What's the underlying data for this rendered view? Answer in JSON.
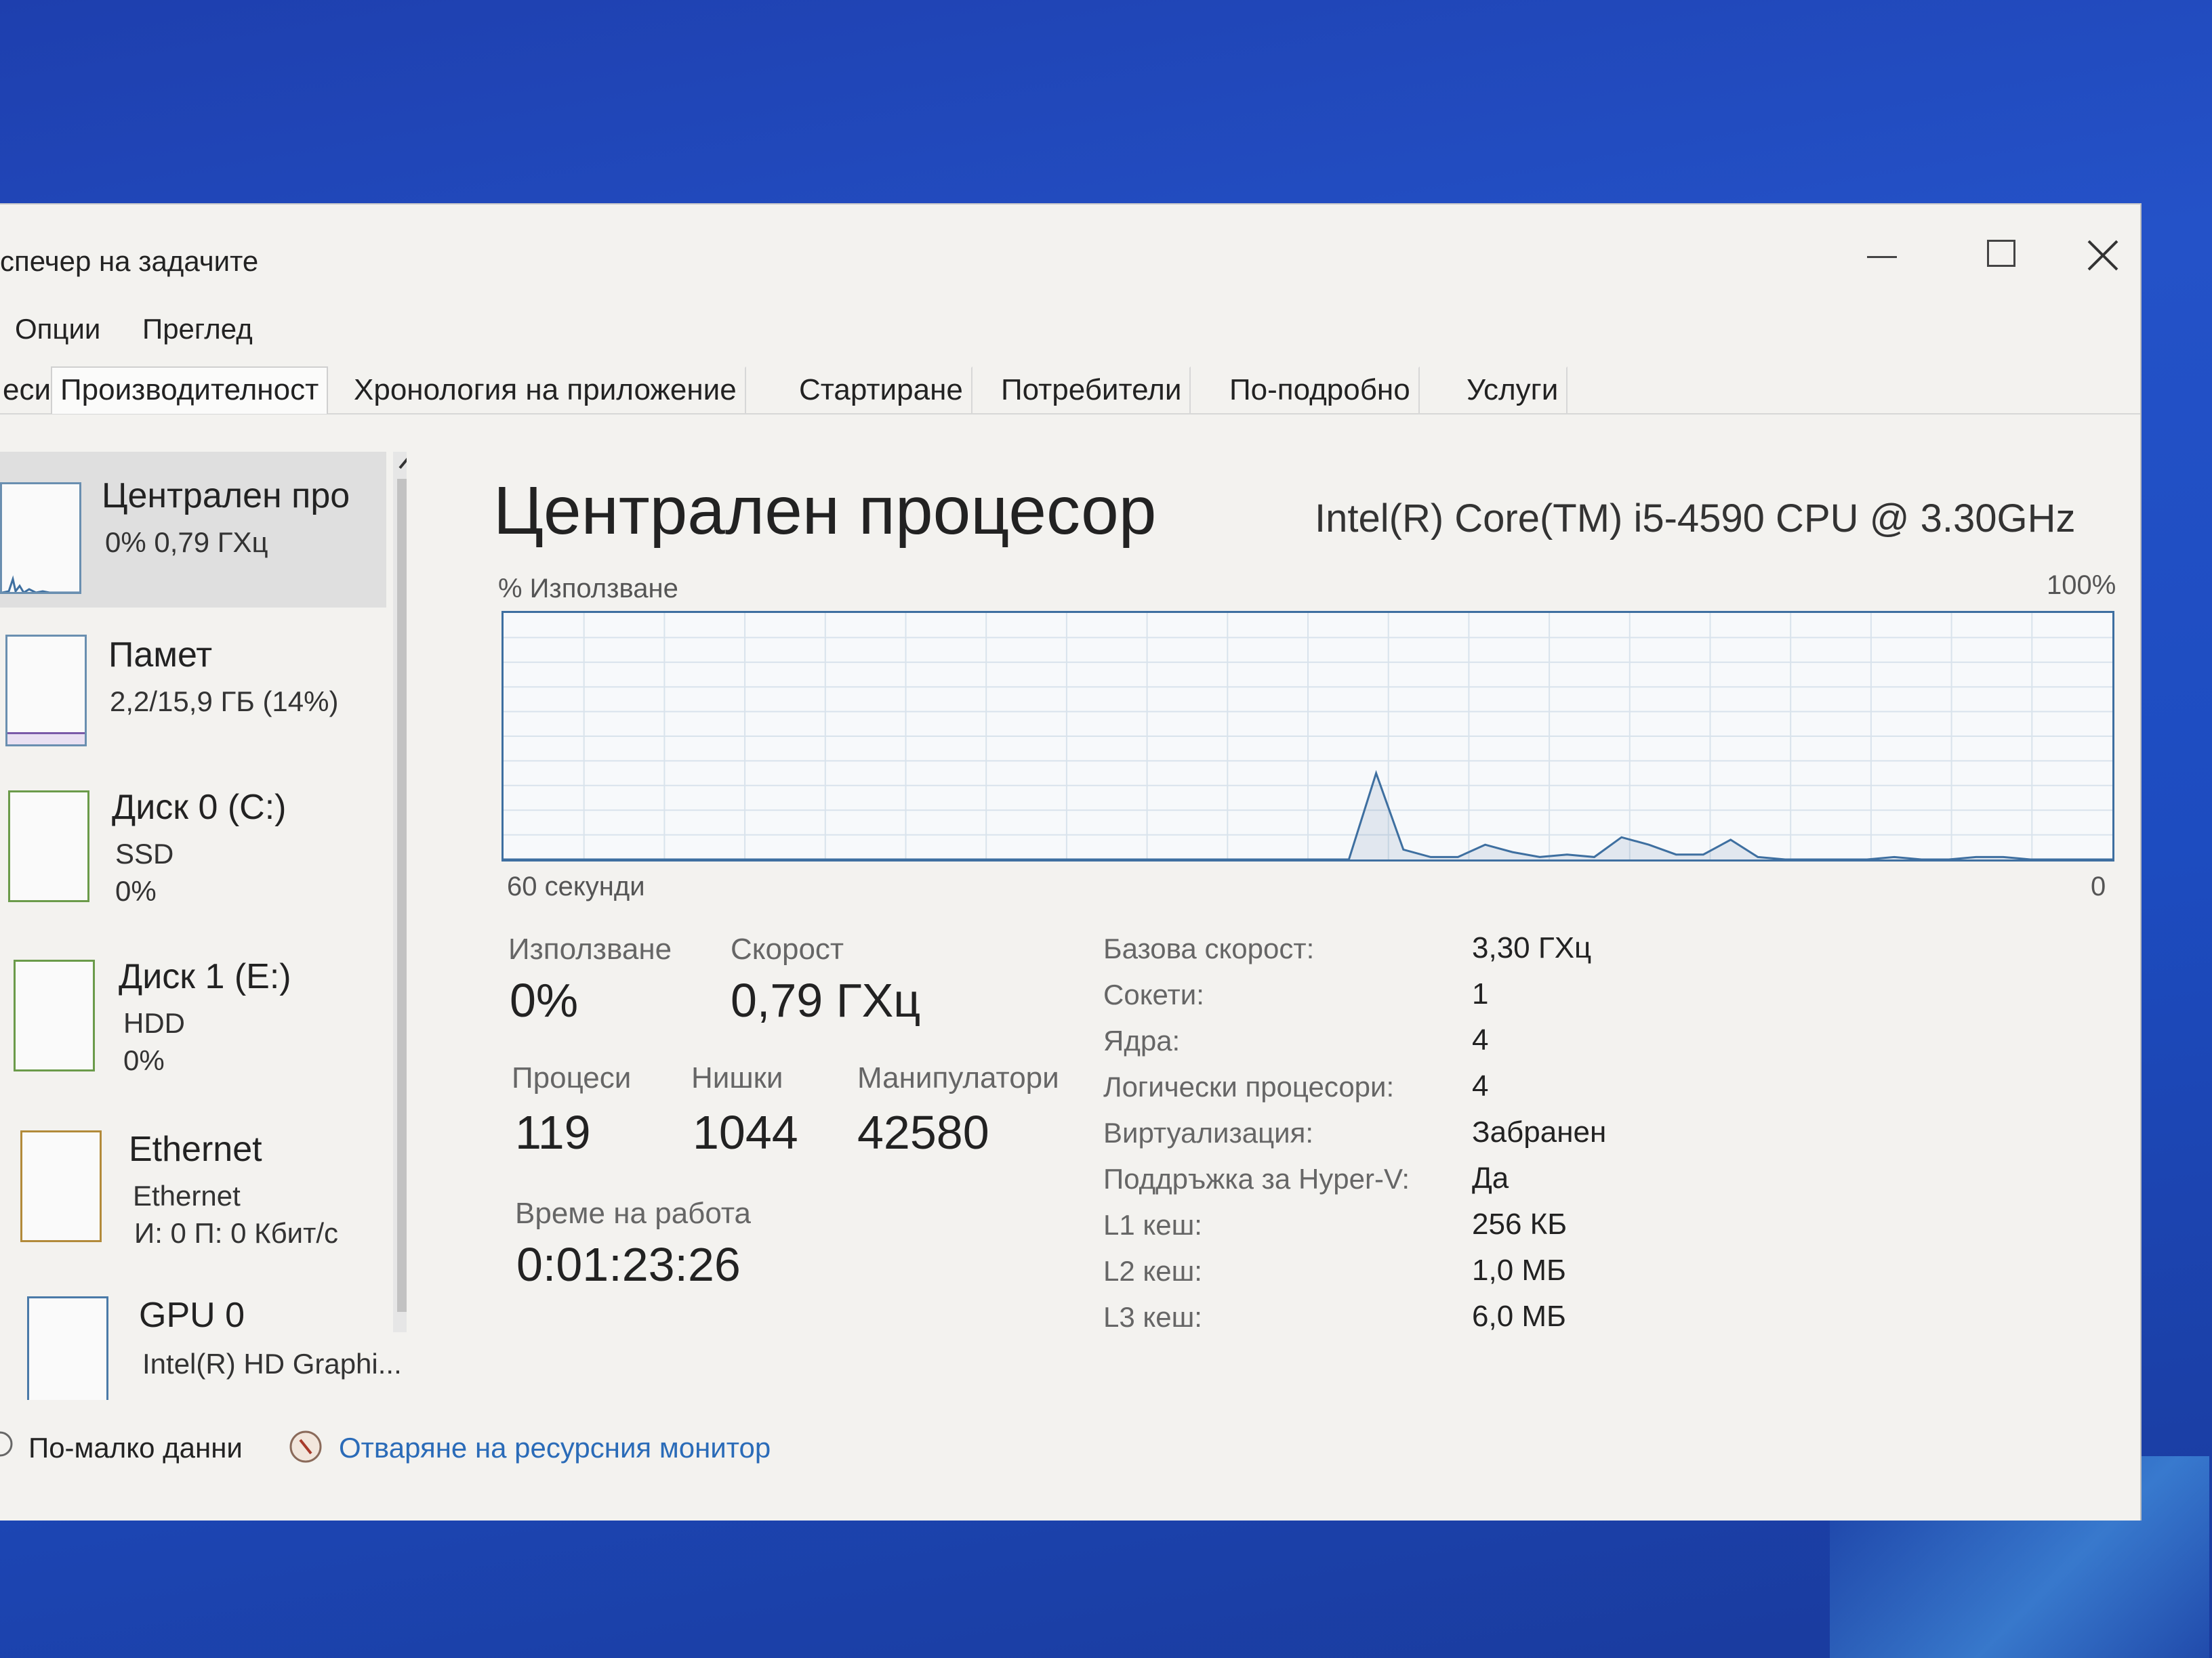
{
  "window": {
    "title": "спечер на задачите",
    "controls": {
      "minimize": "minimize",
      "maximize": "maximize",
      "close": "close"
    }
  },
  "menu": {
    "items": [
      "Опции",
      "Преглед"
    ]
  },
  "tabs": [
    "еси",
    "Производителност",
    "Хронология на приложение",
    "Стартиране",
    "Потребители",
    "По-подробно",
    "Услуги"
  ],
  "active_tab": "Производителност",
  "sidebar": {
    "items": [
      {
        "title": "Централен про",
        "sub1": "0% 0,79 ГХц",
        "sub2": ""
      },
      {
        "title": "Памет",
        "sub1": "2,2/15,9 ГБ (14%)",
        "sub2": ""
      },
      {
        "title": "Диск 0 (C:)",
        "sub1": "SSD",
        "sub2": "0%"
      },
      {
        "title": "Диск 1 (E:)",
        "sub1": "HDD",
        "sub2": "0%"
      },
      {
        "title": "Ethernet",
        "sub1": "Ethernet",
        "sub2": "И: 0 П: 0 Кбит/с"
      },
      {
        "title": "GPU 0",
        "sub1": "Intel(R) HD Graphi...",
        "sub2": ""
      }
    ]
  },
  "main": {
    "title": "Централен процесор",
    "cpu_model": "Intel(R) Core(TM) i5-4590 CPU @ 3.30GHz",
    "graph": {
      "y_label": "% Използване",
      "y_max_label": "100%",
      "x_left_label": "60 секунди",
      "x_right_label": "0",
      "usage_series": [
        0,
        0,
        0,
        0,
        0,
        0,
        0,
        0,
        0,
        0,
        0,
        0,
        0,
        0,
        0,
        0,
        0,
        0,
        0,
        0,
        0,
        0,
        0,
        0,
        0,
        0,
        0,
        0,
        0,
        0,
        0,
        0,
        35,
        4,
        1,
        1,
        6,
        3,
        1,
        2,
        1,
        9,
        6,
        2,
        2,
        8,
        1,
        0,
        0,
        0,
        0,
        1,
        0,
        0,
        1,
        1,
        0,
        0,
        0,
        0
      ]
    },
    "stats": {
      "usage_label": "Използване",
      "usage_value": "0%",
      "speed_label": "Скорост",
      "speed_value": "0,79 ГХц",
      "processes_label": "Процеси",
      "processes_value": "119",
      "threads_label": "Нишки",
      "threads_value": "1044",
      "handles_label": "Манипулатори",
      "handles_value": "42580",
      "uptime_label": "Време на работа",
      "uptime_value": "0:01:23:26"
    },
    "specs": [
      {
        "label": "Базова скорост:",
        "value": "3,30 ГХц"
      },
      {
        "label": "Сокети:",
        "value": "1"
      },
      {
        "label": "Ядра:",
        "value": "4"
      },
      {
        "label": "Логически процесори:",
        "value": "4"
      },
      {
        "label": "Виртуализация:",
        "value": "Забранен"
      },
      {
        "label": "Поддръжка за Hyper-V:",
        "value": "Да"
      },
      {
        "label": "L1 кеш:",
        "value": "256 КБ"
      },
      {
        "label": "L2 кеш:",
        "value": "1,0 МБ"
      },
      {
        "label": "L3 кеш:",
        "value": "6,0 МБ"
      }
    ]
  },
  "footer": {
    "fewer_details": "По-малко данни",
    "resource_monitor": "Отваряне на ресурсния монитор"
  },
  "colors": {
    "desktop": "#1f48bb",
    "window_bg": "#f3f2ef",
    "graph_line": "#3e6fa0",
    "link": "#2a6bb8"
  }
}
